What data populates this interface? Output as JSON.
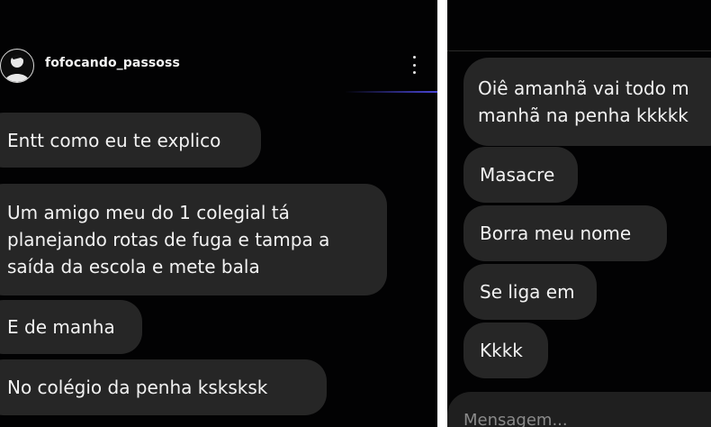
{
  "left": {
    "header": {
      "username": "fofocando_passoss",
      "avatar_icon": "avatar-bust-icon",
      "menu_icon": "more-vertical-icon"
    },
    "messages": [
      "Entt como eu te explico",
      "Um amigo meu do 1 colegial tá\nplanejando rotas de fuga e tampa a\nsaída da escola e mete bala",
      "E de manha",
      "No colégio da penha ksksksk"
    ]
  },
  "right": {
    "messages": [
      "Oiê amanhã vai todo m\nmanhã na penha kkkkk",
      "Masacre",
      "Borra  meu nome",
      "Se liga em",
      "Kkkk"
    ],
    "composer": {
      "placeholder": "Mensagem..."
    }
  },
  "colors": {
    "background": "#020203",
    "bubble": "#262626",
    "text": "#f2f2f2",
    "accent": "#4a46d8"
  }
}
